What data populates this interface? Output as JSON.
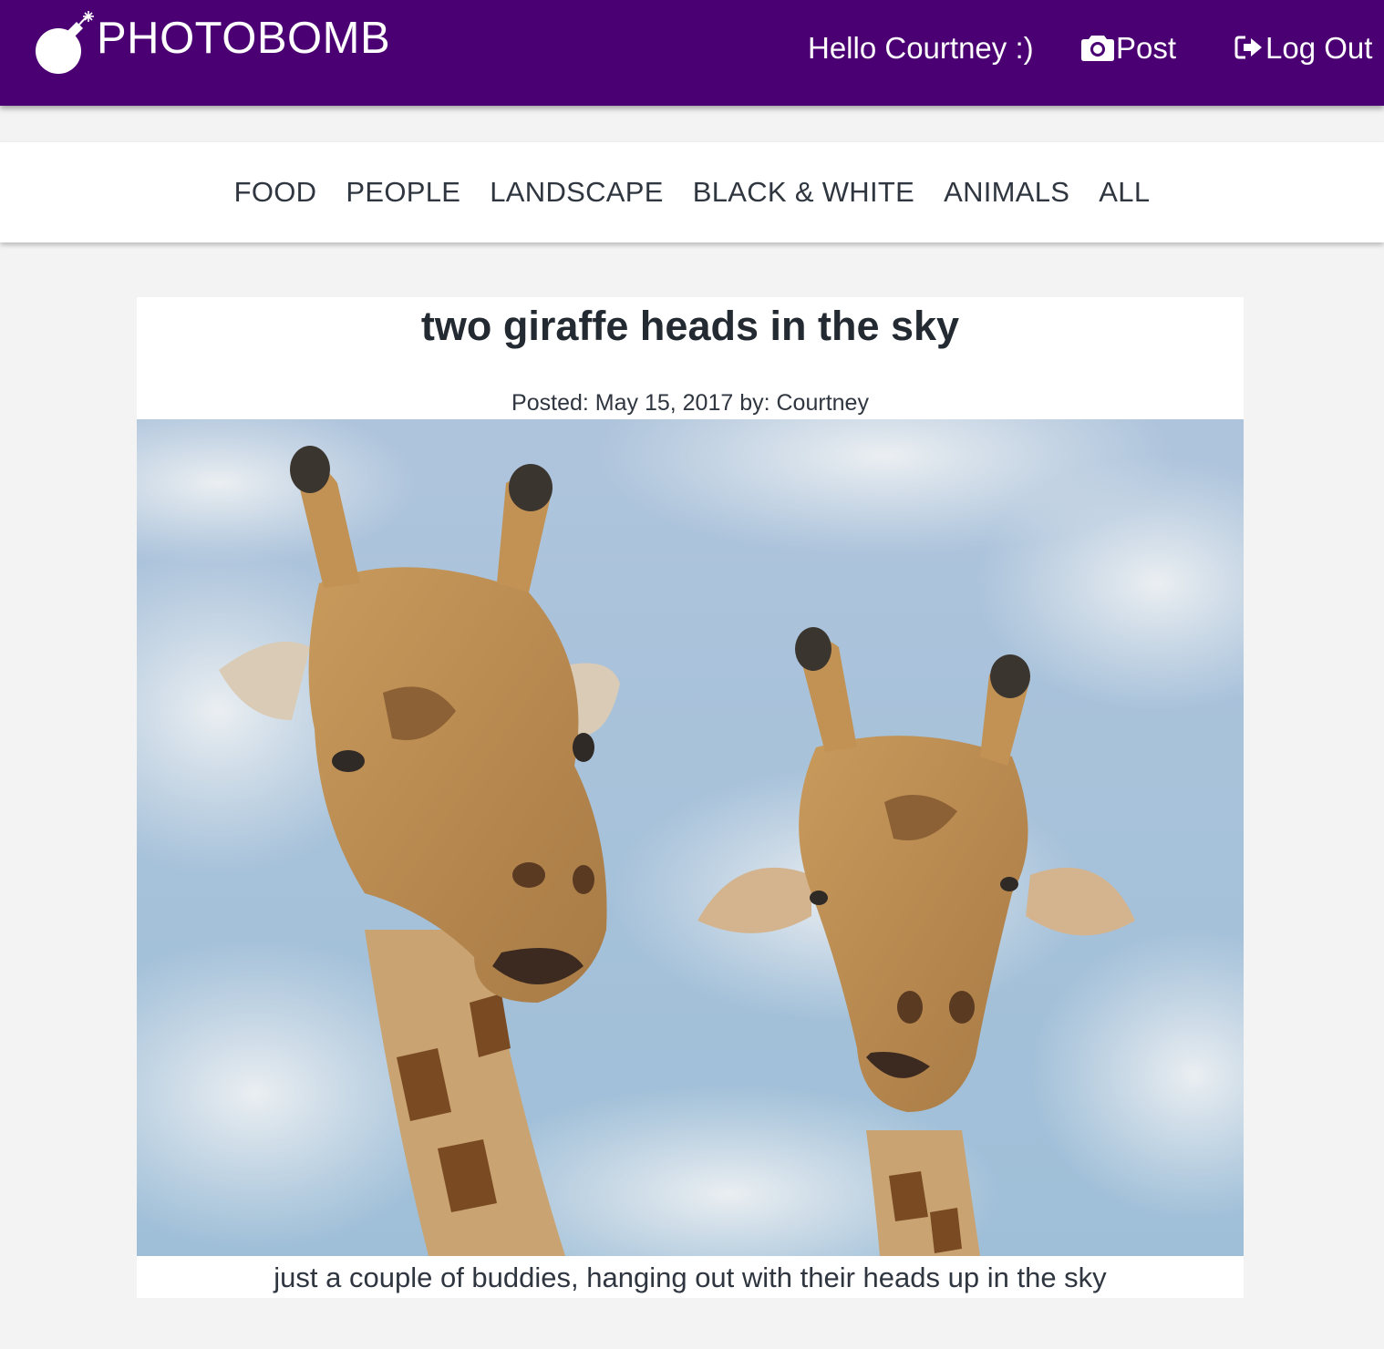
{
  "header": {
    "brand": "PHOTOBOMB",
    "brand_icon": "bomb-icon",
    "greeting": "Hello Courtney :)",
    "post_label": "Post",
    "post_icon": "camera-icon",
    "logout_label": "Log Out",
    "logout_icon": "sign-out-icon",
    "background_color": "#4a0072"
  },
  "categories": [
    "FOOD",
    "PEOPLE",
    "LANDSCAPE",
    "BLACK & WHITE",
    "ANIMALS",
    "ALL"
  ],
  "post": {
    "title": "two giraffe heads in the sky",
    "meta": "Posted: May 15, 2017 by: Courtney",
    "caption": "just a couple of buddies, hanging out with their heads up in the sky"
  }
}
